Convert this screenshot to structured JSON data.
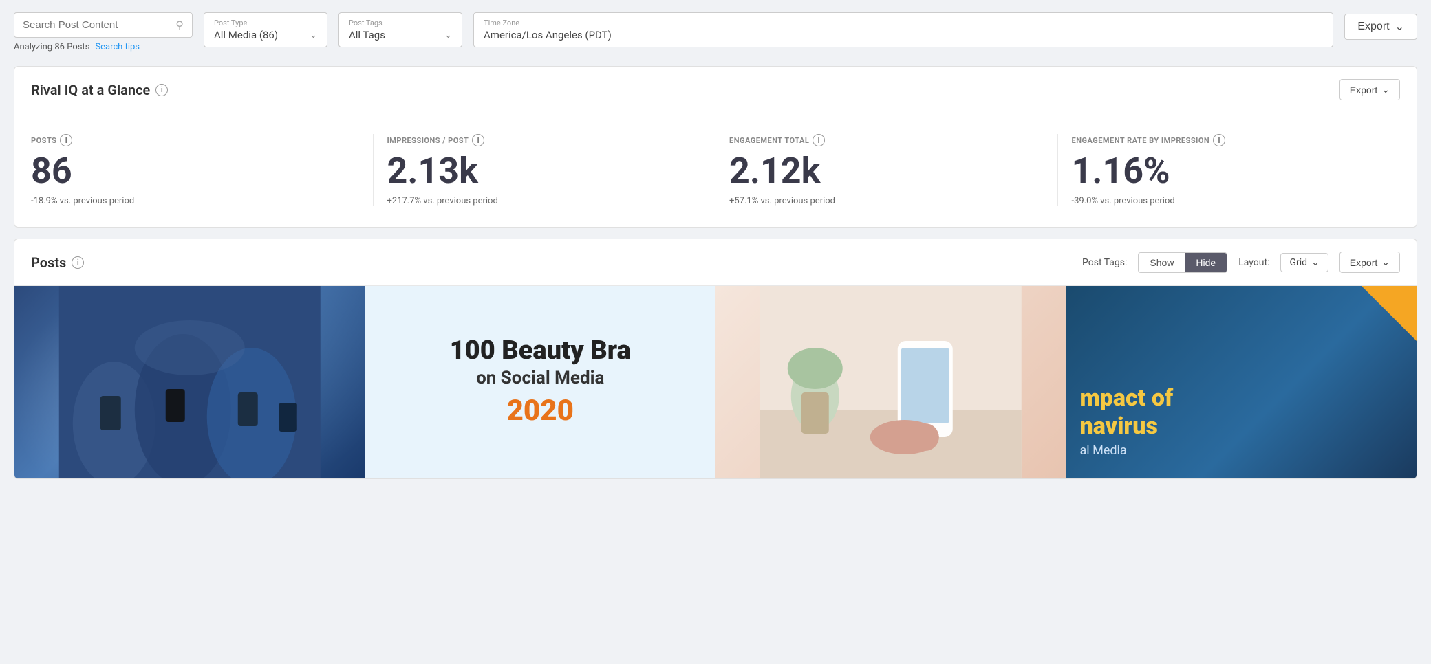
{
  "topbar": {
    "search_placeholder": "Search Post Content",
    "analyzing_text": "Analyzing 86 Posts",
    "search_tips_label": "Search tips",
    "post_type_label": "Post Type",
    "post_type_value": "All Media (86)",
    "post_tags_label": "Post Tags",
    "post_tags_value": "All Tags",
    "timezone_label": "Time Zone",
    "timezone_value": "America/Los Angeles (PDT)",
    "export_main_label": "Export"
  },
  "glance": {
    "title": "Rival IQ at a Glance",
    "export_label": "Export",
    "stats": [
      {
        "label": "POSTS",
        "value": "86",
        "change": "-18.9% vs. previous period"
      },
      {
        "label": "IMPRESSIONS / POST",
        "value": "2.13k",
        "change": "+217.7% vs. previous period"
      },
      {
        "label": "ENGAGEMENT TOTAL",
        "value": "2.12k",
        "change": "+57.1% vs. previous period"
      },
      {
        "label": "ENGAGEMENT RATE BY IMPRESSION",
        "value": "1.16%",
        "change": "-39.0% vs. previous period"
      }
    ]
  },
  "posts_section": {
    "title": "Posts",
    "post_tags_label": "Post Tags:",
    "show_label": "Show",
    "hide_label": "Hide",
    "layout_label": "Layout:",
    "grid_label": "Grid",
    "export_label": "Export",
    "post2_line1": "100 Beauty Bra",
    "post2_line2": "on Social Media",
    "post2_year": "2020",
    "post4_line1": "mpact of",
    "post4_line2": "navirus",
    "post4_line3": "al Media"
  },
  "icons": {
    "search": "&#128269;",
    "chevron_down": "&#8964;",
    "info": "i"
  }
}
